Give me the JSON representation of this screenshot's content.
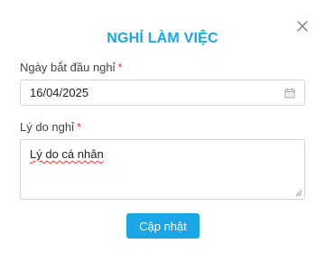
{
  "colors": {
    "accent": "#1aa6e6",
    "required": "#e53935",
    "close_icon": "#7a7f85"
  },
  "dialog": {
    "title": "NGHỈ LÀM VIỆC",
    "close_icon": "close-icon"
  },
  "form": {
    "start_date": {
      "label": "Ngày bắt đầu nghỉ",
      "required_mark": "*",
      "value": "16/04/2025",
      "icon": "calendar-icon"
    },
    "reason": {
      "label": "Lý do nghỉ",
      "required_mark": "*",
      "value": "Lý do cá nhân"
    },
    "submit_label": "Cập nhật"
  }
}
